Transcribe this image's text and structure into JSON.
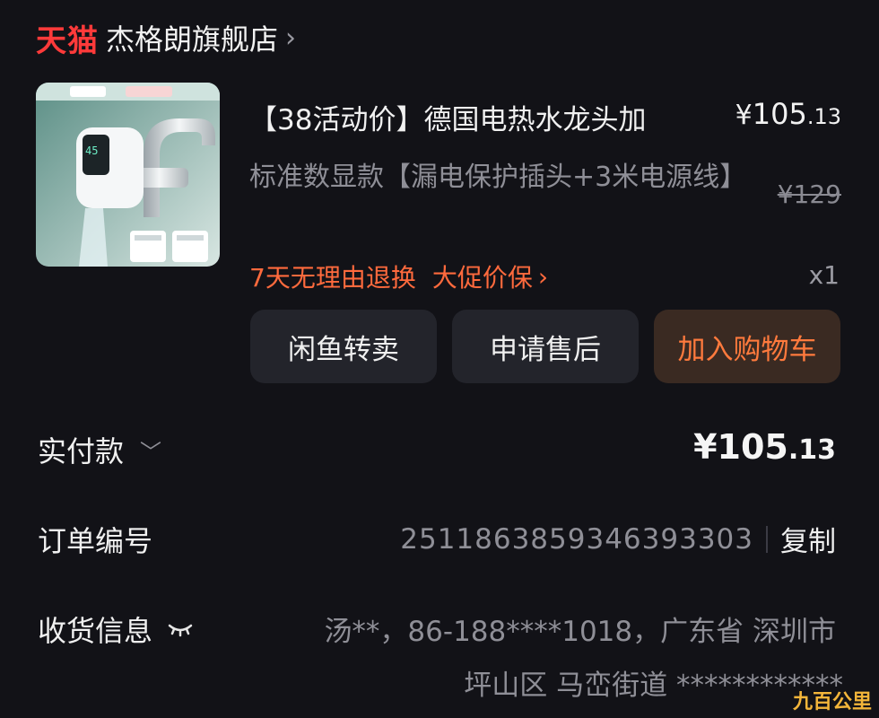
{
  "store": {
    "platform_logo": "天猫",
    "name": "杰格朗旗舰店",
    "chevron_icon": "chevron-right-icon"
  },
  "product": {
    "title": "【38活动价】德国电热水龙头加",
    "sku": "标准数显款【漏电保护插头+3米电源线】",
    "price": {
      "symbol": "¥",
      "integer": "105",
      "decimal": ".13"
    },
    "original_price": "¥129",
    "promises": [
      "7天无理由退换",
      "大促价保"
    ],
    "quantity": "x1"
  },
  "actions": {
    "resell_label": "闲鱼转卖",
    "after_sales_label": "申请售后",
    "add_to_cart_label": "加入购物车"
  },
  "payment": {
    "label": "实付款",
    "amount": {
      "symbol": "¥",
      "integer": "105",
      "decimal": ".13"
    }
  },
  "order": {
    "label": "订单编号",
    "number": "2511863859346393303",
    "copy_label": "复制"
  },
  "shipping": {
    "label": "收货信息",
    "line1": "汤**，86-188****1018，广东省 深圳市",
    "line2": "坪山区 马峦街道 ************"
  },
  "watermark": "九百公里",
  "colors": {
    "background": "#121217",
    "brand_red": "#ff3a3a",
    "accent_orange": "#ff6a3d",
    "button_bg": "#23242b",
    "muted_text": "#8f8f97"
  }
}
